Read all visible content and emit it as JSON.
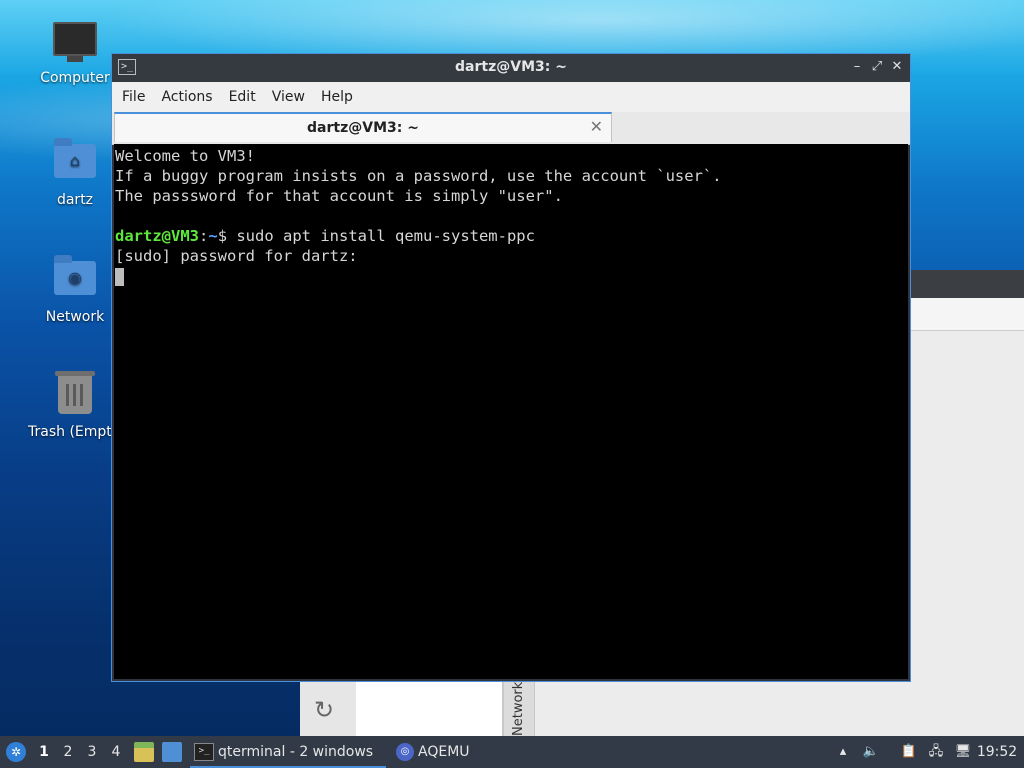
{
  "desktop": {
    "icons": [
      {
        "label": "Computer"
      },
      {
        "label": "dartz"
      },
      {
        "label": "Network"
      },
      {
        "label": "Trash (Empt"
      }
    ]
  },
  "background_window": {
    "vertical_tab": "Network"
  },
  "terminal": {
    "title": "dartz@VM3: ~",
    "menu": [
      "File",
      "Actions",
      "Edit",
      "View",
      "Help"
    ],
    "tab_title": "dartz@VM3: ~",
    "lines": {
      "l1": "Welcome to VM3!",
      "l2": "If a buggy program insists on a password, use the account `user`.",
      "l3": "The passsword for that account is simply \"user\".",
      "prompt_user": "dartz@VM3",
      "prompt_sep": ":",
      "prompt_path": "~",
      "prompt_cmd": "$ sudo apt install qemu-system-ppc",
      "l5": "[sudo] password for dartz:"
    }
  },
  "taskbar": {
    "workspaces": [
      "1",
      "2",
      "3",
      "4"
    ],
    "active_workspace": "1",
    "tasks": [
      {
        "label": "qterminal - 2 windows",
        "icon": "terminal-icon",
        "active": true
      },
      {
        "label": "AQEMU",
        "icon": "aqemu-icon",
        "active": false
      }
    ],
    "clock": "19:52"
  },
  "colors": {
    "accent": "#4a8fd9",
    "prompt_user": "#5ee83c",
    "prompt_path": "#5aa3ff",
    "terminal_bg": "#000000",
    "taskbar_bg": "#313a46"
  }
}
